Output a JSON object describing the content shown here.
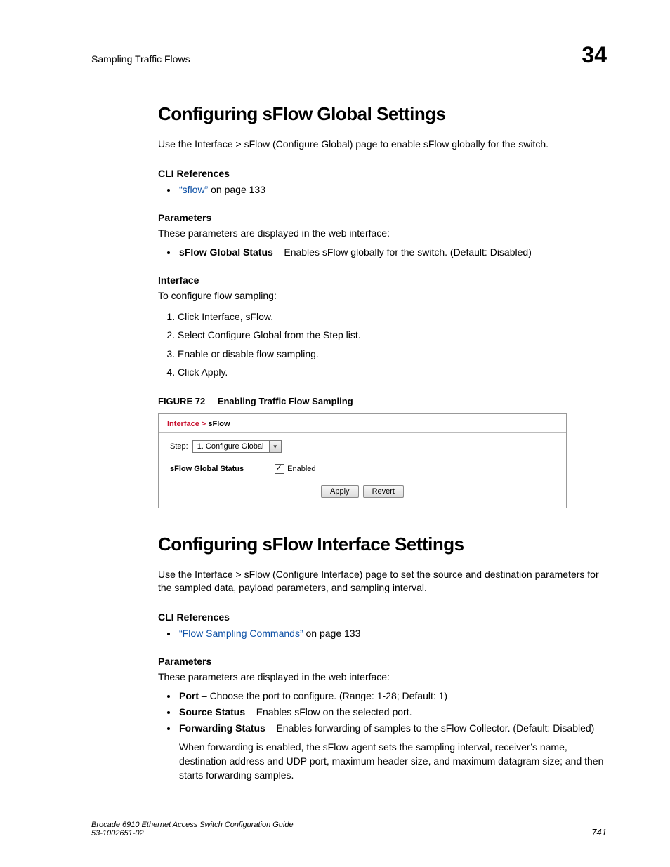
{
  "header": {
    "running_head": "Sampling Traffic Flows",
    "chapter_number": "34"
  },
  "section1": {
    "title": "Configuring sFlow Global Settings",
    "intro": "Use the Interface > sFlow (Configure Global) page to enable sFlow globally for the switch.",
    "cli_head": "CLI References",
    "cli_link": "“sflow”",
    "cli_after": " on page 133",
    "params_head": "Parameters",
    "params_intro": "These parameters are displayed in the web interface:",
    "param1_name": "sFlow Global Status",
    "param1_desc": " – Enables sFlow globally for the switch. (Default: Disabled)",
    "iface_head": "Interface",
    "iface_intro": "To configure flow sampling:",
    "steps": [
      "Click Interface, sFlow.",
      "Select Configure Global from the Step list.",
      "Enable or disable flow sampling.",
      "Click Apply."
    ],
    "figure": {
      "label": "FIGURE 72",
      "title": "Enabling Traffic Flow Sampling",
      "crumb1": "Interface > ",
      "crumb2": "sFlow",
      "step_label": "Step:",
      "step_value": "1. Configure Global",
      "status_label": "sFlow Global Status",
      "enabled_label": "Enabled",
      "btn_apply": "Apply",
      "btn_revert": "Revert"
    }
  },
  "section2": {
    "title": "Configuring sFlow Interface Settings",
    "intro": "Use the Interface > sFlow (Configure Interface) page to set the source and destination parameters for the sampled data, payload parameters, and sampling interval.",
    "cli_head": "CLI References",
    "cli_link": "“Flow Sampling Commands”",
    "cli_after": " on page 133",
    "params_head": "Parameters",
    "params_intro": "These parameters are displayed in the web interface:",
    "p1_name": "Port",
    "p1_desc": " – Choose the port to configure. (Range: 1-28; Default: 1)",
    "p2_name": "Source Status",
    "p2_desc": " – Enables sFlow on the selected port.",
    "p3_name": "Forwarding Status",
    "p3_desc": " – Enables forwarding of samples to the sFlow Collector. (Default: Disabled)",
    "p3_extra": "When forwarding is enabled, the sFlow agent sets the sampling interval, receiver’s name, destination address and UDP port, maximum header size, and maximum datagram size; and then starts forwarding samples."
  },
  "footer": {
    "line1": "Brocade 6910 Ethernet Access Switch Configuration Guide",
    "line2": "53-1002651-02",
    "page": "741"
  }
}
